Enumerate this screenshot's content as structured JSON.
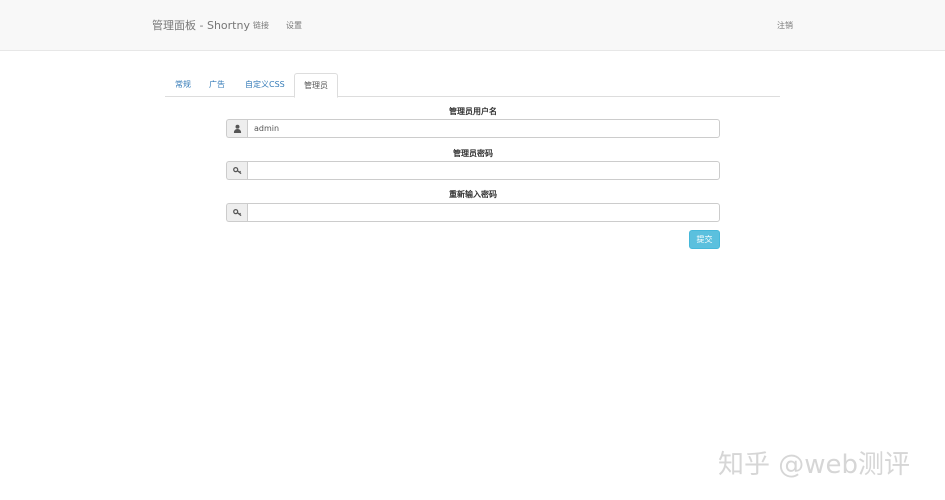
{
  "navbar": {
    "brand": "管理面板 - Shortny",
    "links": [
      "链接",
      "设置"
    ],
    "logout": "注销"
  },
  "tabs": [
    {
      "label": "常规",
      "active": false
    },
    {
      "label": "广告",
      "active": false
    },
    {
      "label": "自定义CSS",
      "active": false
    },
    {
      "label": "管理员",
      "active": true
    }
  ],
  "form": {
    "username": {
      "label": "管理员用户名",
      "value": "admin",
      "icon": "user-icon"
    },
    "password": {
      "label": "管理员密码",
      "value": "",
      "icon": "key-icon"
    },
    "confirm": {
      "label": "重新输入密码",
      "value": "",
      "icon": "key-icon"
    },
    "submit": "提交"
  },
  "watermark": "知乎 @web测评",
  "colors": {
    "submit": "#5bc0de",
    "link": "#337ab7",
    "navbar": "#f8f8f8"
  }
}
